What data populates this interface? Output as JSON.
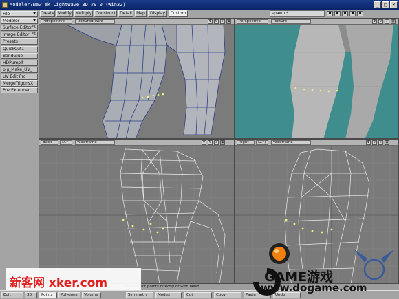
{
  "window": {
    "title": "Modeler?NewTek LightWave 3D ?9.0 (Win32)",
    "controls": [
      "_",
      "□",
      "×"
    ]
  },
  "left_panel": {
    "file_menu": "File",
    "modeler_menu": "Modeler",
    "items": [
      {
        "label": "Surface Editor",
        "shortcut": "F5"
      },
      {
        "label": "Image Editor",
        "shortcut": "F6"
      },
      {
        "label": "Presets",
        "shortcut": ""
      }
    ],
    "custom_tools": [
      "QuickCut1",
      "BandGlue",
      "HDPumpIt",
      "plg_Make_UV_",
      "UV Edit Pro",
      "MergeTrigonsX",
      "Poz Extender"
    ]
  },
  "tabs": {
    "items": [
      "Create",
      "Modify",
      "Multiply",
      "Construct",
      "Detail",
      "Map",
      "Display",
      "Custom"
    ],
    "active": "Custom"
  },
  "layer_select": {
    "value": "spawn *"
  },
  "viewports": [
    {
      "id": "top-left",
      "view": "Perspective",
      "shading": "Textured Wire"
    },
    {
      "id": "top-right",
      "view": "Perspective",
      "shading": "Texture"
    },
    {
      "id": "bottom-left",
      "view": "Back",
      "axis": "(XY)",
      "shading": "Wireframe"
    },
    {
      "id": "bottom-right",
      "view": "Right",
      "axis": "(ZY)",
      "shading": "Wireframe"
    }
  ],
  "status": {
    "message": "...nd deselect points directly or with lasso."
  },
  "bottom_bar": {
    "edit_label": "Edit",
    "sel_count": "38",
    "modes": [
      "Points",
      "Polygons",
      "Volume"
    ],
    "active_mode": "Points",
    "symmetry_label": "Symmetry",
    "modes_label": "Modes",
    "actions": [
      "Cut",
      "Copy",
      "Paste",
      "Undo"
    ]
  },
  "watermarks": {
    "left": "新客网 xker.com",
    "right_brand": "GAME游戏",
    "right_url": "www.dogame.com"
  },
  "colors": {
    "title_bar": "#0a246a",
    "viewport_bg": "#7a7a7a",
    "texture_viewport_bg": "#3f8d8d",
    "mesh_fill": "#a8acb3",
    "mesh_wire": "#2c3f86",
    "wireframe_line": "#e8e8e8",
    "selected_point": "#f5f07a",
    "watermark_red": "#e02020",
    "logo_orange": "#f08010"
  }
}
